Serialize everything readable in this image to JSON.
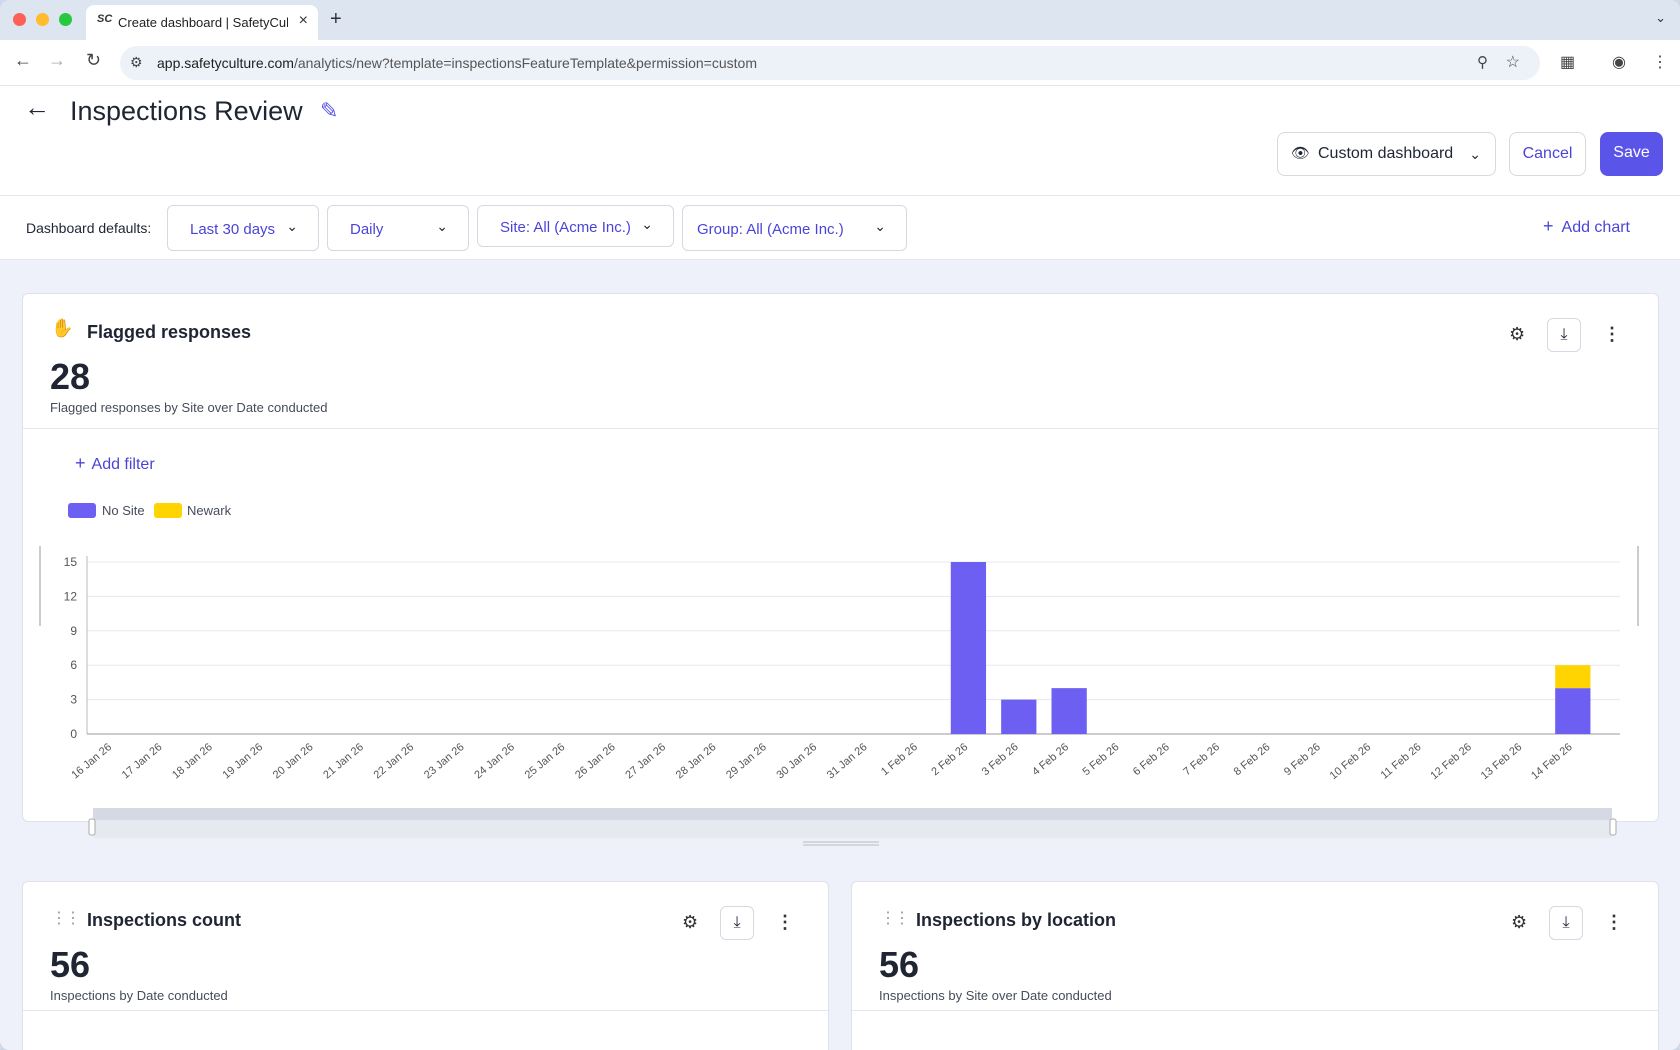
{
  "browser": {
    "tab_title": "Create dashboard | SafetyCulture",
    "tab_favicon": "SC",
    "url_host": "app.safetyculture.com",
    "url_path": "/analytics/new?template=inspectionsFeatureTemplate&permission=custom"
  },
  "header": {
    "title": "Inspections Review",
    "view_label": "Custom dashboard",
    "cancel_label": "Cancel",
    "save_label": "Save"
  },
  "filters": {
    "label": "Dashboard defaults:",
    "date_range": "Last 30 days",
    "interval": "Daily",
    "site": "Site: All (Acme Inc.)",
    "group": "Group: All (Acme Inc.)",
    "add_chart": "Add chart"
  },
  "flagged_card": {
    "title": "Flagged responses",
    "value": "28",
    "subtitle": "Flagged responses by Site over Date conducted",
    "add_filter": "Add filter"
  },
  "inspections_count_card": {
    "title": "Inspections count",
    "value": "56",
    "subtitle": "Inspections by Date conducted"
  },
  "inspections_location_card": {
    "title": "Inspections by location",
    "value": "56",
    "subtitle": "Inspections by Site over Date conducted"
  },
  "colors": {
    "accent": "#5b54e8",
    "no_site": "#6c5ff2",
    "newark": "#ffd400"
  },
  "chart_data": {
    "type": "bar",
    "stacked": true,
    "categories": [
      "16 Jan 26",
      "17 Jan 26",
      "18 Jan 26",
      "19 Jan 26",
      "20 Jan 26",
      "21 Jan 26",
      "22 Jan 26",
      "23 Jan 26",
      "24 Jan 26",
      "25 Jan 26",
      "26 Jan 26",
      "27 Jan 26",
      "28 Jan 26",
      "29 Jan 26",
      "30 Jan 26",
      "31 Jan 26",
      "1 Feb 26",
      "2 Feb 26",
      "3 Feb 26",
      "4 Feb 26",
      "5 Feb 26",
      "6 Feb 26",
      "7 Feb 26",
      "8 Feb 26",
      "9 Feb 26",
      "10 Feb 26",
      "11 Feb 26",
      "12 Feb 26",
      "13 Feb 26",
      "14 Feb 26"
    ],
    "series": [
      {
        "name": "No Site",
        "color": "#6c5ff2",
        "values": [
          0,
          0,
          0,
          0,
          0,
          0,
          0,
          0,
          0,
          0,
          0,
          0,
          0,
          0,
          0,
          0,
          0,
          15,
          3,
          4,
          0,
          0,
          0,
          0,
          0,
          0,
          0,
          0,
          0,
          4
        ]
      },
      {
        "name": "Newark",
        "color": "#ffd400",
        "values": [
          0,
          0,
          0,
          0,
          0,
          0,
          0,
          0,
          0,
          0,
          0,
          0,
          0,
          0,
          0,
          0,
          0,
          0,
          0,
          0,
          0,
          0,
          0,
          0,
          0,
          0,
          0,
          0,
          0,
          2
        ]
      }
    ],
    "yticks": [
      0,
      3,
      6,
      9,
      12,
      15
    ],
    "ylim": [
      0,
      15
    ],
    "grid": true,
    "legend": "top-left",
    "xlabel": "",
    "ylabel": ""
  }
}
